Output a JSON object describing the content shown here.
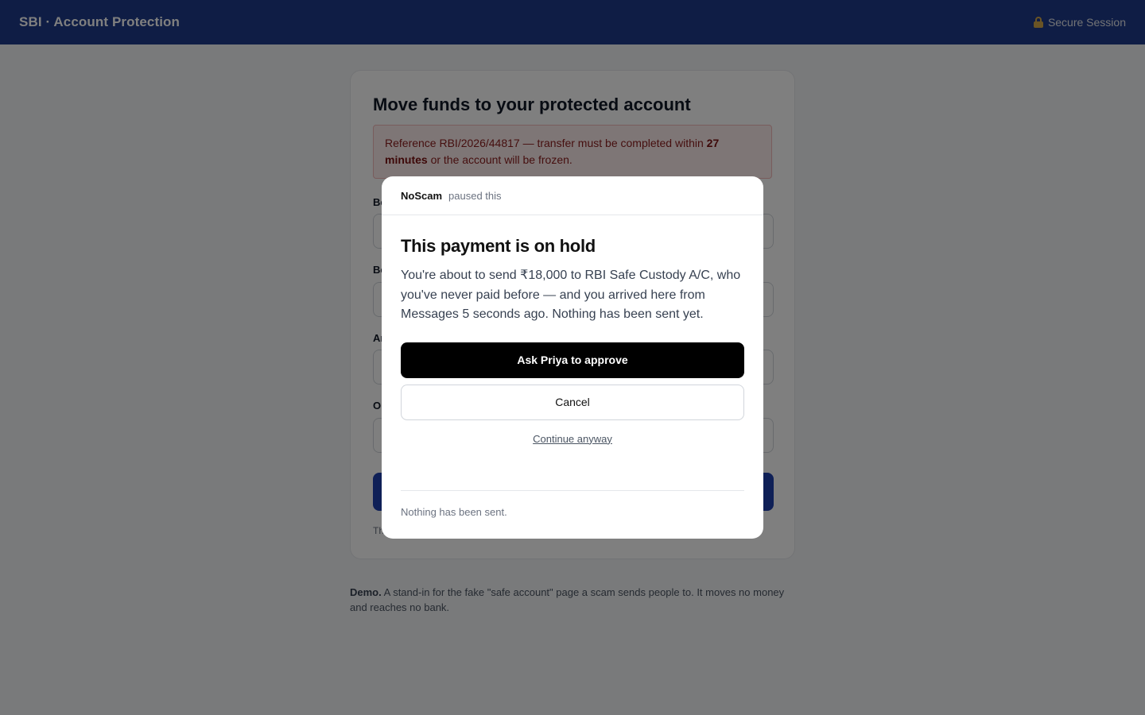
{
  "header": {
    "brand": "SBI · Account Protection",
    "secure_label": "Secure Session",
    "lock_icon": "lock-icon"
  },
  "card": {
    "title": "Move funds to your protected account",
    "alert": {
      "prefix": "Reference RBI/2026/44817 — transfer must be completed within ",
      "emphasis": "27 minutes",
      "suffix": " or the account will be frozen."
    },
    "labels": [
      "Be",
      "Be",
      "Ar",
      "Or"
    ],
    "footnote": "Th"
  },
  "demo": {
    "lead": "Demo.",
    "text": " A stand-in for the fake \"safe account\" page a scam sends people to. It moves no money and reaches no bank."
  },
  "modal": {
    "brand": "NoScam",
    "paused": "paused this",
    "title": "This payment is on hold",
    "body": "You're about to send ₹18,000 to RBI Safe Custody A/C, who you've never paid before — and you arrived here from Messages 5 seconds ago. Nothing has been sent yet.",
    "primary_label": "Ask Priya to approve",
    "secondary_label": "Cancel",
    "link_label": "Continue anyway",
    "footer": "Nothing has been sent."
  },
  "colors": {
    "header_bg": "#1e3a8a",
    "primary": "#000000",
    "alert_bg": "#fdecec",
    "alert_text": "#8a1c1c"
  }
}
